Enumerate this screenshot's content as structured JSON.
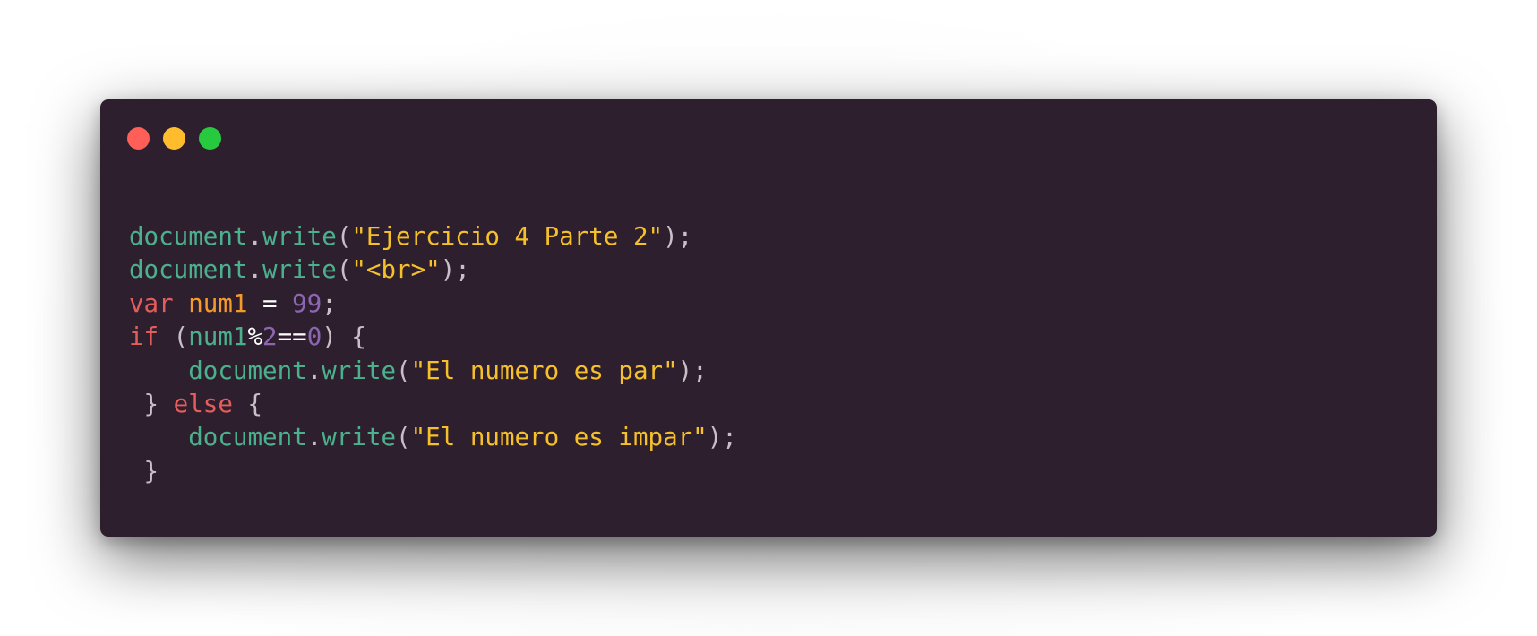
{
  "window": {
    "controls": {
      "close": "close",
      "minimize": "minimize",
      "maximize": "maximize"
    },
    "colors": {
      "background": "#2e1f2f",
      "close": "#ff5f56",
      "minimize": "#ffbd2e",
      "maximize": "#27c93f"
    }
  },
  "code": {
    "language": "javascript",
    "lines": [
      {
        "tokens": [
          {
            "t": "fn",
            "v": "document"
          },
          {
            "t": "punc",
            "v": "."
          },
          {
            "t": "fn",
            "v": "write"
          },
          {
            "t": "punc",
            "v": "("
          },
          {
            "t": "str",
            "v": "\"Ejercicio 4 Parte 2\""
          },
          {
            "t": "punc",
            "v": ");"
          }
        ]
      },
      {
        "tokens": [
          {
            "t": "fn",
            "v": "document"
          },
          {
            "t": "punc",
            "v": "."
          },
          {
            "t": "fn",
            "v": "write"
          },
          {
            "t": "punc",
            "v": "("
          },
          {
            "t": "str",
            "v": "\"<br>\""
          },
          {
            "t": "punc",
            "v": ");"
          }
        ]
      },
      {
        "tokens": [
          {
            "t": "kw",
            "v": "var"
          },
          {
            "t": "punc",
            "v": " "
          },
          {
            "t": "var",
            "v": "num1"
          },
          {
            "t": "punc",
            "v": " "
          },
          {
            "t": "op",
            "v": "="
          },
          {
            "t": "punc",
            "v": " "
          },
          {
            "t": "num",
            "v": "99"
          },
          {
            "t": "punc",
            "v": ";"
          }
        ]
      },
      {
        "tokens": [
          {
            "t": "kw",
            "v": "if"
          },
          {
            "t": "punc",
            "v": " ("
          },
          {
            "t": "fn",
            "v": "num1"
          },
          {
            "t": "op",
            "v": "%"
          },
          {
            "t": "num",
            "v": "2"
          },
          {
            "t": "op",
            "v": "=="
          },
          {
            "t": "num",
            "v": "0"
          },
          {
            "t": "punc",
            "v": ") {"
          }
        ]
      },
      {
        "tokens": [
          {
            "t": "punc",
            "v": "    "
          },
          {
            "t": "fn",
            "v": "document"
          },
          {
            "t": "punc",
            "v": "."
          },
          {
            "t": "fn",
            "v": "write"
          },
          {
            "t": "punc",
            "v": "("
          },
          {
            "t": "str",
            "v": "\"El numero es par\""
          },
          {
            "t": "punc",
            "v": ");"
          }
        ]
      },
      {
        "tokens": [
          {
            "t": "punc",
            "v": " } "
          },
          {
            "t": "kw",
            "v": "else"
          },
          {
            "t": "punc",
            "v": " {"
          }
        ]
      },
      {
        "tokens": [
          {
            "t": "punc",
            "v": "    "
          },
          {
            "t": "fn",
            "v": "document"
          },
          {
            "t": "punc",
            "v": "."
          },
          {
            "t": "fn",
            "v": "write"
          },
          {
            "t": "punc",
            "v": "("
          },
          {
            "t": "str",
            "v": "\"El numero es impar\""
          },
          {
            "t": "punc",
            "v": ");"
          }
        ]
      },
      {
        "tokens": [
          {
            "t": "punc",
            "v": " }"
          }
        ]
      }
    ]
  }
}
